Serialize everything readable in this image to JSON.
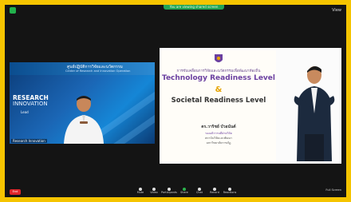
{
  "topbar": {
    "view_only_label": "You are viewing shared screen",
    "view_button_label": "View"
  },
  "left_tile": {
    "banner_line1": "ศูนย์ปฏิบัติการวิจัยและนวัตกรรม",
    "banner_line2": "Center of Research and Innovation Operation",
    "research_word": "RESEARCH",
    "research_word2": "INNOVATION",
    "small_text": "Lead",
    "participant_name": "Research Innovation"
  },
  "slide": {
    "line1": "การขับเคลื่อนการวิจัยและนวัตกรรมเพื่อพัฒนาท้องถิ่น",
    "trl_title": "Technology Readiness Level",
    "ampersand": "&",
    "srl_title": "Societal Readiness Level",
    "presenter_name": "ดร.วาริชย์ บัวอนันต์",
    "presenter_title1": "รองอธิการบดีฝ่ายวิจัย",
    "presenter_title2": "สถาบันวิจัยและพัฒนา",
    "presenter_title3": "มหาวิทยาลัยราชภัฏ"
  },
  "toolbar": {
    "end_label": "End",
    "items": [
      {
        "icon": "microphone-icon",
        "label": "Mute"
      },
      {
        "icon": "video-icon",
        "label": "Video"
      },
      {
        "icon": "participants-icon",
        "label": "Participants"
      },
      {
        "icon": "share-screen-icon",
        "label": "Share"
      },
      {
        "icon": "chat-icon",
        "label": "Chat"
      },
      {
        "icon": "record-icon",
        "label": "Record"
      },
      {
        "icon": "reactions-icon",
        "label": "Reactions"
      }
    ],
    "right_label": "Full Screen"
  },
  "colors": {
    "frame_border": "#f5c400",
    "end_button": "#e0262b",
    "trl_purple": "#6a3fa0",
    "amp_gold": "#e6a400"
  }
}
